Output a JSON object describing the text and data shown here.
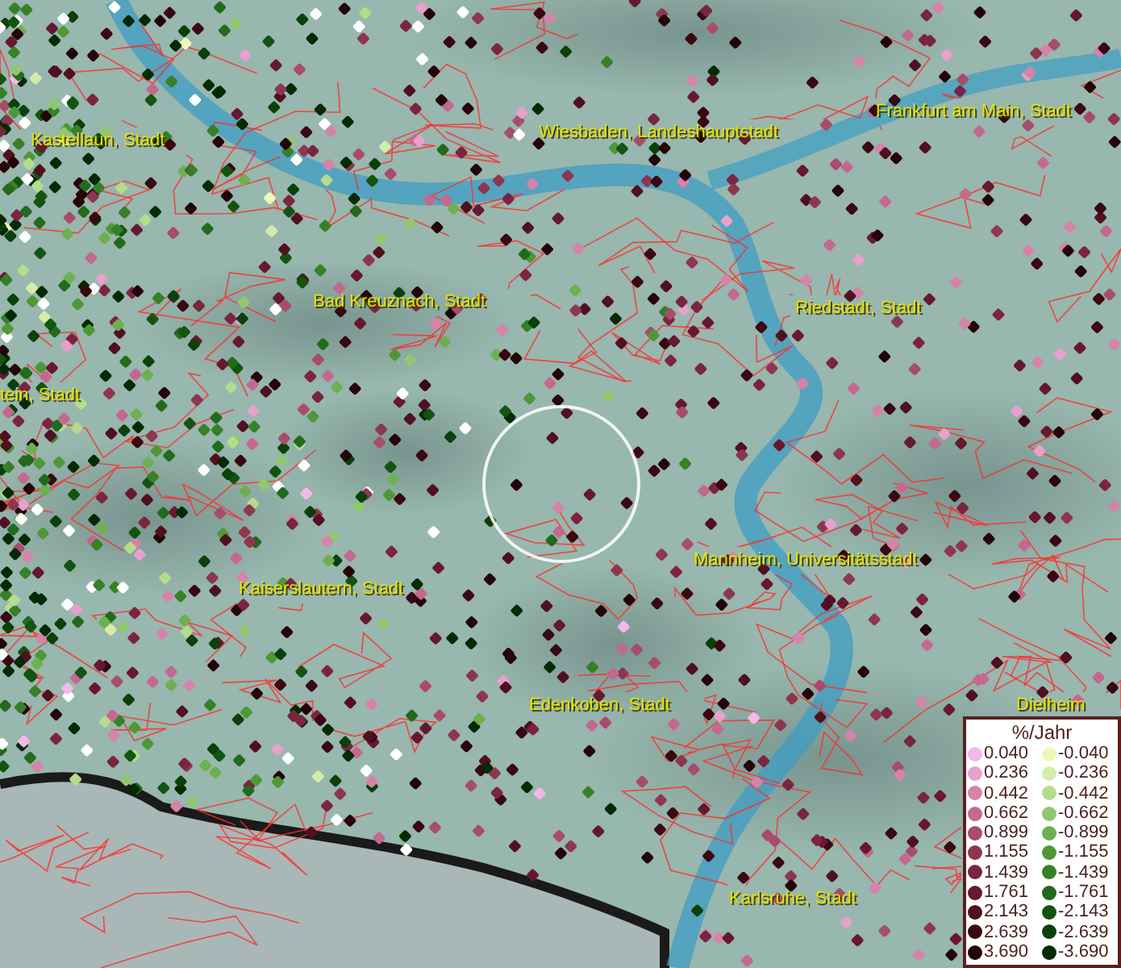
{
  "map": {
    "place_labels": [
      {
        "text": "Kastellaun, Stadt"
      },
      {
        "text": "Wiesbaden, Landeshauptstadt"
      },
      {
        "text": "Frankfurt am Main, Stadt"
      },
      {
        "text": "Bad Kreuznach, Stadt"
      },
      {
        "text": "Riedstadt, Stadt"
      },
      {
        "text": "tein, Stadt"
      },
      {
        "text": "Mannheim, Universitätsstadt"
      },
      {
        "text": "Kaiserslautern, Stadt"
      },
      {
        "text": "Edenkoben, Stadt"
      },
      {
        "text": "Karlsruhe, Stadt"
      },
      {
        "text": "Dielheim"
      }
    ]
  },
  "legend": {
    "title": "%/Jahr",
    "positive": [
      {
        "value": "0.040",
        "color": "#f4b8e4"
      },
      {
        "value": "0.236",
        "color": "#e8a0cc"
      },
      {
        "value": "0.442",
        "color": "#d683aa"
      },
      {
        "value": "0.662",
        "color": "#c46890"
      },
      {
        "value": "0.899",
        "color": "#a84c6c"
      },
      {
        "value": "1.155",
        "color": "#8e3650"
      },
      {
        "value": "1.439",
        "color": "#7a2440"
      },
      {
        "value": "1.761",
        "color": "#661830"
      },
      {
        "value": "2.143",
        "color": "#501020"
      },
      {
        "value": "2.639",
        "color": "#3a0812"
      },
      {
        "value": "3.690",
        "color": "#240408"
      }
    ],
    "negative": [
      {
        "value": "-0.040",
        "color": "#f0f8b8"
      },
      {
        "value": "-0.236",
        "color": "#d4ecaa"
      },
      {
        "value": "-0.442",
        "color": "#b4dc8c"
      },
      {
        "value": "-0.662",
        "color": "#90c870"
      },
      {
        "value": "-0.899",
        "color": "#6cb050"
      },
      {
        "value": "-1.155",
        "color": "#4e9838"
      },
      {
        "value": "-1.439",
        "color": "#368028"
      },
      {
        "value": "-1.761",
        "color": "#226a1c"
      },
      {
        "value": "-2.143",
        "color": "#125410"
      },
      {
        "value": "-2.639",
        "color": "#0a400a"
      },
      {
        "value": "-3.690",
        "color": "#042a04"
      }
    ]
  }
}
